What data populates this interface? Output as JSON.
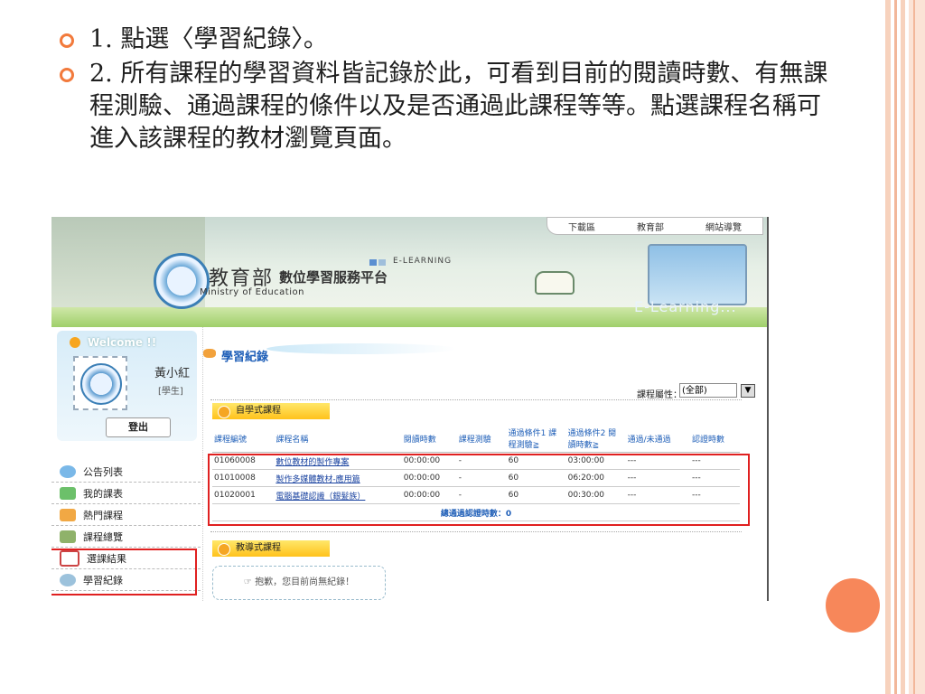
{
  "slide": {
    "bullets": [
      "1. 點選〈學習紀錄〉。",
      "2. 所有課程的學習資料皆記錄於此，可看到目前的閱讀時數、有無課程測驗、通過課程的條件以及是否通過此課程等等。點選課程名稱可進入該課程的教材瀏覽頁面。"
    ],
    "accent_color": "#f27a3c"
  },
  "portal": {
    "title": "教育部",
    "subtitle": "數位學習服務平台",
    "english": "Ministry of Education",
    "tag": "E-LEARNING",
    "monitor_text": "E-Learning...",
    "topnav": [
      "下載區",
      "教育部",
      "網站導覽"
    ],
    "welcome": "Welcome !!",
    "user_name": "黃小紅",
    "user_role": "[學生]",
    "logout": "登出",
    "menu": [
      "公告列表",
      "我的課表",
      "熱門課程",
      "課程總覽",
      "選課結果",
      "學習紀錄"
    ],
    "page_heading": "學習紀錄",
    "filter_label": "課程屬性：",
    "filter_value": "(全部)",
    "self_study_tab": "自學式課程",
    "guided_tab": "教導式課程",
    "empty_message": "☞ 抱歉，您目前尚無紀錄！",
    "columns": [
      "課程編號",
      "課程名稱",
      "閱讀時數",
      "課程測驗",
      "通過條件1 課程測驗≧",
      "通過條件2 閱讀時數≧",
      "通過/未通過",
      "認證時數"
    ],
    "rows": [
      [
        "01060008",
        "數位教材的製作專案",
        "00:00:00",
        "-",
        "60",
        "03:00:00",
        "---",
        "---"
      ],
      [
        "01010008",
        "製作多媒體教材-應用篇",
        "00:00:00",
        "-",
        "60",
        "06:20:00",
        "---",
        "---"
      ],
      [
        "01020001",
        "電腦基礎認識（銀髮族）",
        "00:00:00",
        "-",
        "60",
        "00:30:00",
        "---",
        "---"
      ]
    ],
    "total": "總通過認證時數：0"
  }
}
